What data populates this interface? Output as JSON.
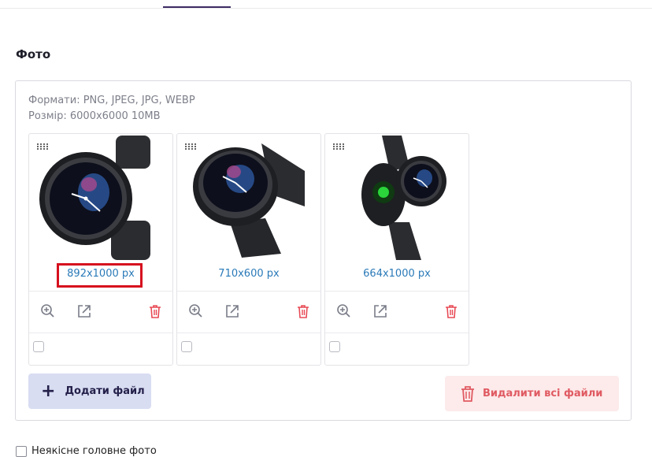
{
  "section": {
    "title": "Фото",
    "formats_text": "Формати: PNG, JPEG, JPG, WEBP",
    "size_text": "Розмір: 6000x6000 10MB"
  },
  "images": [
    {
      "dims": "892x1000 px",
      "highlighted": true
    },
    {
      "dims": "710x600 px",
      "highlighted": false
    },
    {
      "dims": "664x1000 px",
      "highlighted": false
    }
  ],
  "actions": {
    "zoom_icon": "zoom-in-icon",
    "open_icon": "external-link-icon",
    "delete_icon": "trash-icon"
  },
  "buttons": {
    "add_label": "Додати файл",
    "delete_all_label": "Видалити всі файли"
  },
  "bottom_checkbox_label": "Неякісне головне фото",
  "colors": {
    "accent": "#3d2b63",
    "link": "#2a7ab8",
    "danger": "#e84a55",
    "highlight": "#d6101e"
  }
}
